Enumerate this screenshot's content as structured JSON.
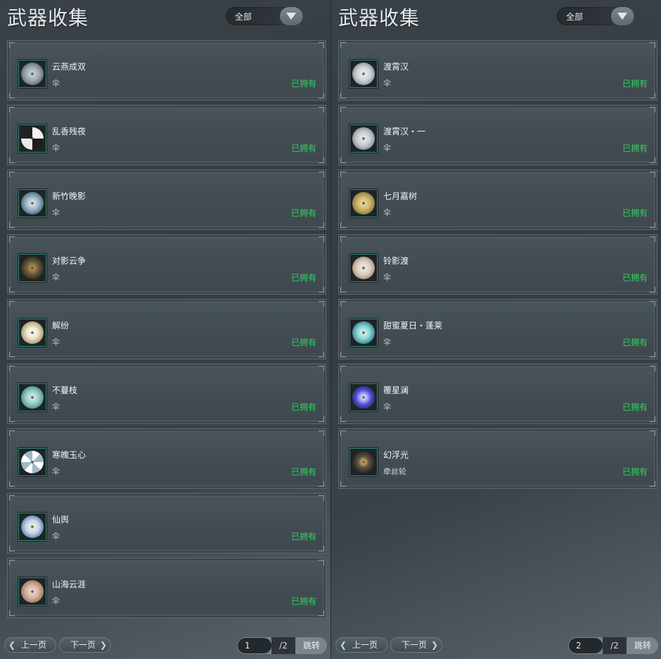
{
  "panels": [
    {
      "title": "武器收集",
      "filter": "全部",
      "items": [
        {
          "name": "云燕成双",
          "type": "伞",
          "status": "已拥有",
          "art": "radial-gradient(circle at 50% 50%, #d5dbe0 0%, #9aa6ae 45%, #5f6b73 75%, #2c3438 100%)"
        },
        {
          "name": "乱香残夜",
          "type": "伞",
          "status": "已拥有",
          "art": "conic-gradient(#f2f2f2 0 25%, #1c1c1c 25% 50%, #e9e9e9 50% 75%, #222 75% 100%)"
        },
        {
          "name": "新竹晚影",
          "type": "伞",
          "status": "已拥有",
          "art": "radial-gradient(circle at 50% 50%, #e8f2f8 0%, #9bb6c6 40%, #4f6c7e 75%, #223038 100%)"
        },
        {
          "name": "对影云争",
          "type": "伞",
          "status": "已拥有",
          "art": "radial-gradient(circle at 50% 50%, #c9a35a 0%, #6d5a3a 40%, #2e2a24 75%, #141414 100%)"
        },
        {
          "name": "解纷",
          "type": "伞",
          "status": "已拥有",
          "art": "radial-gradient(circle at 50% 50%, #ffffff 0%, #efe6cf 35%, #b8ab86 65%, #3a3428 100%)"
        },
        {
          "name": "不蔓枝",
          "type": "伞",
          "status": "已拥有",
          "art": "radial-gradient(circle at 50% 50%, #e2f3ef 0%, #98cfc5 40%, #4d8f86 75%, #1d3b38 100%)"
        },
        {
          "name": "寒魄玉心",
          "type": "伞",
          "status": "已拥有",
          "art": "conic-gradient(#ffffff 0 12%, #9fb9c9 12% 25%, #ffffff 25% 37%, #9fb9c9 37% 50%, #ffffff 50% 62%, #9fb9c9 62% 75%, #ffffff 75% 87%, #9fb9c9 87% 100%)"
        },
        {
          "name": "仙舆",
          "type": "伞",
          "status": "已拥有",
          "art": "radial-gradient(circle at 50% 50%, #f8f3e2 0%, #c7d8e6 40%, #6f8fb4 70%, #d0a84a 100%)"
        },
        {
          "name": "山海云涯",
          "type": "伞",
          "status": "已拥有",
          "art": "radial-gradient(circle at 50% 50%, #f3e2d6 0%, #d6b3a1 40%, #a77e6c 70%, #4b3a33 100%)"
        }
      ],
      "pager": {
        "prev": "上一页",
        "next": "下一页",
        "page": "1",
        "total": "/2",
        "jump": "跳转"
      }
    },
    {
      "title": "武器收集",
      "filter": "全部",
      "items": [
        {
          "name": "渡霄汉",
          "type": "伞",
          "status": "已拥有",
          "art": "radial-gradient(circle at 50% 50%, #f1f3f5 0%, #c9cfd4 45%, #8a939a 75%, #3a4045 100%)"
        },
        {
          "name": "渡霄汉・一",
          "type": "伞",
          "status": "已拥有",
          "art": "radial-gradient(circle at 50% 50%, #eef1f3 0%, #c2c9ce 45%, #868f96 75%, #363c41 100%)"
        },
        {
          "name": "七月嘉树",
          "type": "伞",
          "status": "已拥有",
          "art": "radial-gradient(circle at 50% 50%, #efe1a6 0%, #cdb66a 40%, #8c7a3e 75%, #3a3220 100%)"
        },
        {
          "name": "铃影渡",
          "type": "伞",
          "status": "已拥有",
          "art": "radial-gradient(circle at 50% 50%, #f3eee6 0%, #d9ccbd 45%, #a08e7c 75%, #3f3730 100%)"
        },
        {
          "name": "甜蜜夏日・蓬莱",
          "type": "伞",
          "status": "已拥有",
          "art": "radial-gradient(circle at 50% 50%, #e9f7f4 0%, #8fd3cd 40%, #3f8fa0 70%, #1c3a44 100%)"
        },
        {
          "name": "覆星澜",
          "type": "伞",
          "status": "已拥有",
          "art": "radial-gradient(circle at 50% 50%, #ffffff 0%, #b6b4ff 20%, #4d49c9 50%, #15133f 100%)"
        },
        {
          "name": "幻浮光",
          "type": "牵丝轮",
          "status": "已拥有",
          "art": "radial-gradient(circle at 50% 50%, #ffe08a 0%, #b89a52 15%, #5b544a 35%, #2a2623 70%, #8c8f92 100%)"
        }
      ],
      "pager": {
        "prev": "上一页",
        "next": "下一页",
        "page": "2",
        "total": "/2",
        "jump": "跳转"
      }
    }
  ]
}
